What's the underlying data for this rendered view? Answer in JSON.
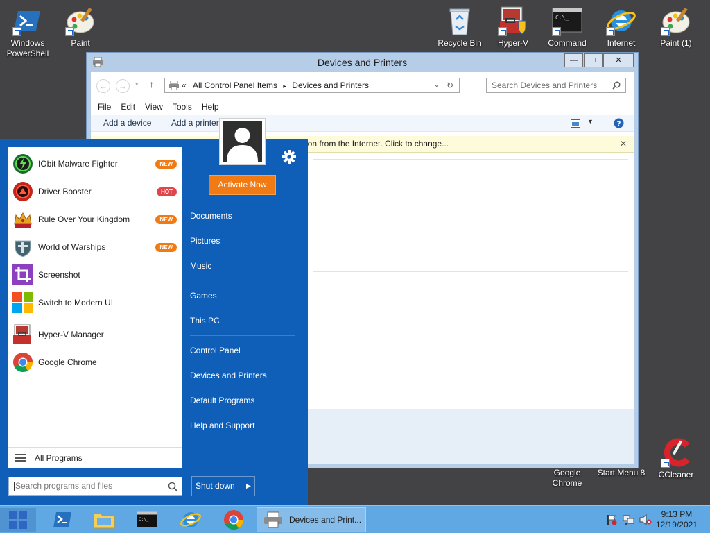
{
  "desktop_icons": {
    "powershell": "Windows PowerShell",
    "paint": "Paint",
    "recycle_bin": "Recycle Bin",
    "hyperv": "Hyper-V",
    "command": "Command",
    "internet": "Internet",
    "paint1": "Paint (1)",
    "chrome": "Google Chrome",
    "startmenu8": "Start Menu 8",
    "ccleaner": "CCleaner"
  },
  "window": {
    "title": "Devices and Printers",
    "minimize": "—",
    "maximize": "□",
    "close": "✕",
    "address_prefix": "«",
    "address_crumb_1": "All Control Panel Items",
    "address_sep": "▸",
    "address_crumb_2": "Devices and Printers",
    "search_placeholder": "Search Devices and Printers",
    "menu": [
      "File",
      "Edit",
      "View",
      "Tools",
      "Help"
    ],
    "add_device": "Add a device",
    "add_printer": "Add a printer",
    "infobar_text": "ion from the Internet. Click to change...",
    "infobar_close": "✕"
  },
  "start_menu": {
    "programs": [
      {
        "name": "IObit Malware Fighter",
        "badge": "NEW",
        "badge_color": "#f07b14",
        "icon_color": "#1a6b2f"
      },
      {
        "name": "Driver Booster",
        "badge": "HOT",
        "badge_color": "#e0454a",
        "icon_color": "#c8231a"
      },
      {
        "name": "Rule Over Your Kingdom",
        "badge": "NEW",
        "badge_color": "#f07b14",
        "icon_color": "#c98a1a"
      },
      {
        "name": "World of Warships",
        "badge": "NEW",
        "badge_color": "#f07b14",
        "icon_color": "#44636e"
      },
      {
        "name": "Screenshot",
        "badge": "",
        "badge_color": "",
        "icon_color": "#8c3fbf"
      },
      {
        "name": "Switch to Modern UI",
        "badge": "",
        "badge_color": "",
        "icon_color": "#f25022"
      }
    ],
    "pinned": [
      {
        "name": "Hyper-V Manager"
      },
      {
        "name": "Google Chrome"
      }
    ],
    "all_programs": "All Programs",
    "search_placeholder": "Search programs and files",
    "activate": "Activate Now",
    "links_a": [
      "Documents",
      "Pictures",
      "Music"
    ],
    "links_b": [
      "Games",
      "This PC"
    ],
    "links_c": [
      "Control Panel",
      "Devices and Printers",
      "Default Programs",
      "Help and Support"
    ],
    "shutdown": "Shut down"
  },
  "taskbar": {
    "task_label": "Devices and Print...",
    "time": "9:13 PM",
    "date": "12/19/2021"
  }
}
